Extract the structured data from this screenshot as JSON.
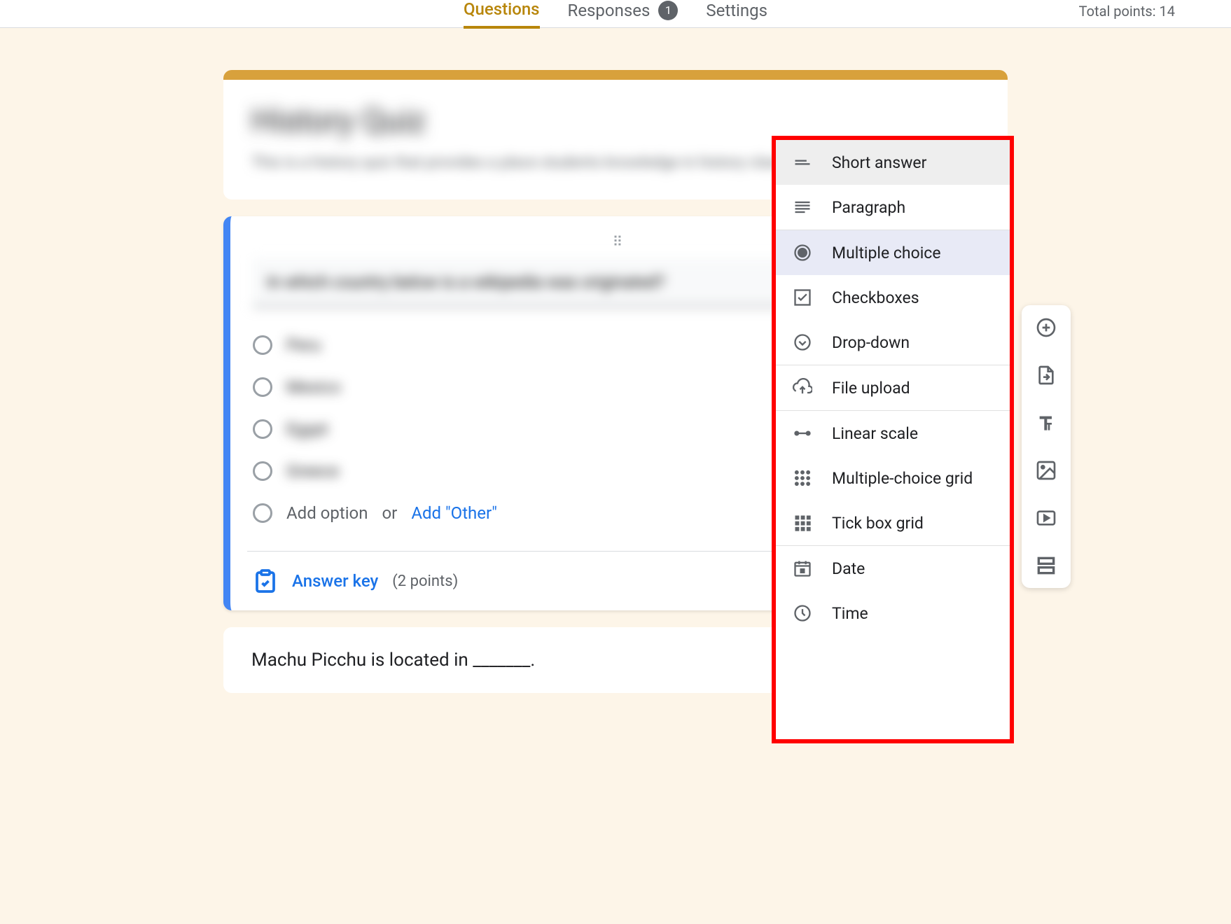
{
  "topbar": {
    "tabs": {
      "questions": "Questions",
      "responses": "Responses",
      "responsesBadge": "1",
      "settings": "Settings"
    },
    "totalPoints": "Total points: 14"
  },
  "header": {
    "title": "History Quiz",
    "description": "This is a history quiz that provides a place students knowledge in history class"
  },
  "question": {
    "text": "In which country below is a wikipedia was originated?",
    "options": [
      "Peru",
      "Mexico",
      "Egypt",
      "Greece"
    ],
    "addOption": "Add option",
    "or": "or",
    "addOther": "Add \"Other\"",
    "answerKey": "Answer key",
    "pointsLabel": "(2 points)"
  },
  "nextQuestion": {
    "text": "Machu Picchu is located in _______."
  },
  "typeMenu": {
    "shortAnswer": "Short answer",
    "paragraph": "Paragraph",
    "multipleChoice": "Multiple choice",
    "checkboxes": "Checkboxes",
    "dropdown": "Drop-down",
    "fileUpload": "File upload",
    "linearScale": "Linear scale",
    "mcGrid": "Multiple-choice grid",
    "tickGrid": "Tick box grid",
    "date": "Date",
    "time": "Time"
  }
}
